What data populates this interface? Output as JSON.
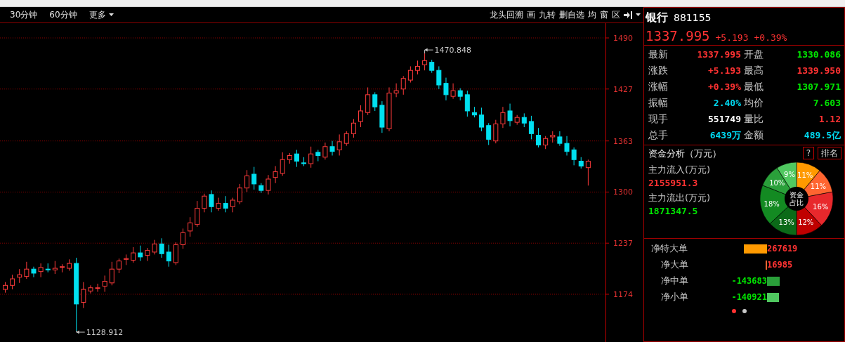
{
  "toolbar": {
    "left": [
      {
        "label": "30分钟",
        "dropdown": false
      },
      {
        "label": "60分钟",
        "dropdown": false
      },
      {
        "label": "更多",
        "dropdown": true
      }
    ],
    "right": [
      "龙头回溯",
      "画",
      "九转",
      "删自选",
      "均",
      "窗",
      "区"
    ]
  },
  "chart": {
    "chart_data": {
      "type": "candlestick",
      "grid": true,
      "ohlc": [
        [
          1180,
          1189,
          1176,
          1185
        ],
        [
          1185,
          1198,
          1180,
          1193
        ],
        [
          1195,
          1205,
          1188,
          1198
        ],
        [
          1196,
          1214,
          1193,
          1205
        ],
        [
          1205,
          1208,
          1195,
          1200
        ],
        [
          1202,
          1212,
          1195,
          1207
        ],
        [
          1205,
          1212,
          1201,
          1204
        ],
        [
          1204,
          1215,
          1199,
          1206
        ],
        [
          1208,
          1211,
          1201,
          1208
        ],
        [
          1206,
          1217,
          1203,
          1212
        ],
        [
          1212,
          1219,
          1128.912,
          1162
        ],
        [
          1164,
          1189,
          1157,
          1180
        ],
        [
          1178,
          1185,
          1175,
          1182
        ],
        [
          1182,
          1187,
          1177,
          1182
        ],
        [
          1184,
          1197,
          1177,
          1190
        ],
        [
          1188,
          1214,
          1185,
          1205
        ],
        [
          1205,
          1218,
          1200,
          1215
        ],
        [
          1217,
          1223,
          1210,
          1218
        ],
        [
          1216,
          1232,
          1213,
          1225
        ],
        [
          1225,
          1234,
          1215,
          1220
        ],
        [
          1222,
          1231,
          1215,
          1228
        ],
        [
          1226,
          1241,
          1223,
          1236
        ],
        [
          1236,
          1243,
          1219,
          1224
        ],
        [
          1226,
          1235,
          1208,
          1215
        ],
        [
          1213,
          1238,
          1210,
          1235
        ],
        [
          1235,
          1255,
          1230,
          1250
        ],
        [
          1252,
          1269,
          1245,
          1262
        ],
        [
          1260,
          1289,
          1257,
          1280
        ],
        [
          1280,
          1298,
          1275,
          1295
        ],
        [
          1297,
          1302,
          1275,
          1282
        ],
        [
          1280,
          1293,
          1277,
          1286
        ],
        [
          1286,
          1295,
          1275,
          1280
        ],
        [
          1282,
          1293,
          1275,
          1290
        ],
        [
          1288,
          1310,
          1285,
          1305
        ],
        [
          1305,
          1327,
          1300,
          1320
        ],
        [
          1322,
          1331,
          1303,
          1310
        ],
        [
          1308,
          1311,
          1299,
          1302
        ],
        [
          1302,
          1321,
          1297,
          1316
        ],
        [
          1318,
          1332,
          1311,
          1325
        ],
        [
          1323,
          1349,
          1320,
          1340
        ],
        [
          1340,
          1348,
          1335,
          1345
        ],
        [
          1347,
          1352,
          1331,
          1338
        ],
        [
          1336,
          1343,
          1332,
          1335
        ],
        [
          1335,
          1356,
          1330,
          1347
        ],
        [
          1349,
          1352,
          1338,
          1345
        ],
        [
          1343,
          1361,
          1340,
          1356
        ],
        [
          1356,
          1363,
          1345,
          1350
        ],
        [
          1352,
          1371,
          1345,
          1362
        ],
        [
          1360,
          1375,
          1357,
          1372
        ],
        [
          1372,
          1390,
          1367,
          1385
        ],
        [
          1387,
          1407,
          1380,
          1400
        ],
        [
          1398,
          1429,
          1395,
          1420
        ],
        [
          1420,
          1423,
          1400,
          1405
        ],
        [
          1407,
          1412,
          1373,
          1380
        ],
        [
          1378,
          1429,
          1375,
          1422
        ],
        [
          1422,
          1434,
          1417,
          1425
        ],
        [
          1427,
          1443,
          1420,
          1440
        ],
        [
          1438,
          1455,
          1435,
          1450
        ],
        [
          1450,
          1462,
          1445,
          1455
        ],
        [
          1457,
          1470.848,
          1450,
          1462
        ],
        [
          1460,
          1463,
          1447,
          1450
        ],
        [
          1450,
          1455,
          1427,
          1432
        ],
        [
          1434,
          1441,
          1413,
          1420
        ],
        [
          1418,
          1434,
          1415,
          1425
        ],
        [
          1425,
          1428,
          1413,
          1418
        ],
        [
          1420,
          1425,
          1393,
          1400
        ],
        [
          1398,
          1405,
          1392,
          1395
        ],
        [
          1395,
          1404,
          1375,
          1380
        ],
        [
          1382,
          1385,
          1358,
          1365
        ],
        [
          1363,
          1389,
          1360,
          1384
        ],
        [
          1384,
          1405,
          1379,
          1398
        ],
        [
          1400,
          1409,
          1381,
          1388
        ],
        [
          1386,
          1395,
          1383,
          1392
        ],
        [
          1392,
          1397,
          1380,
          1385
        ],
        [
          1387,
          1394,
          1365,
          1372
        ],
        [
          1370,
          1379,
          1355,
          1358
        ],
        [
          1358,
          1369,
          1353,
          1366
        ],
        [
          1368,
          1375,
          1361,
          1370
        ],
        [
          1368,
          1375,
          1357,
          1360
        ],
        [
          1360,
          1369,
          1345,
          1350
        ],
        [
          1352,
          1355,
          1333,
          1340
        ],
        [
          1338,
          1343,
          1329,
          1332
        ],
        [
          1330.086,
          1339.95,
          1307.971,
          1337.995
        ]
      ],
      "ylim": [
        1115,
        1490
      ],
      "yticks": [
        1490,
        1427,
        1363,
        1300,
        1237,
        1174
      ],
      "annotations": [
        "1470.848",
        "1128.912"
      ]
    }
  },
  "quote": {
    "name": "银行",
    "code": "881155",
    "price": "1337.995",
    "change": "+5.193",
    "change_pct": "+0.39%",
    "stats": [
      {
        "label": "最新",
        "value": "1337.995",
        "color": "#ff3232"
      },
      {
        "label": "开盘",
        "value": "1330.086",
        "color": "#00e600"
      },
      {
        "label": "涨跌",
        "value": "+5.193",
        "color": "#ff3232"
      },
      {
        "label": "最高",
        "value": "1339.950",
        "color": "#ff3232"
      },
      {
        "label": "涨幅",
        "value": "+0.39%",
        "color": "#ff3232"
      },
      {
        "label": "最低",
        "value": "1307.971",
        "color": "#00e600"
      },
      {
        "label": "振幅",
        "value": "2.40%",
        "color": "#00d8f0"
      },
      {
        "label": "均价",
        "value": "7.603",
        "color": "#00e600"
      },
      {
        "label": "现手",
        "value": "551749",
        "color": "#ffffff"
      },
      {
        "label": "量比",
        "value": "1.12",
        "color": "#ff3232"
      },
      {
        "label": "总手",
        "value": "6439万",
        "color": "#00d8f0"
      },
      {
        "label": "金额",
        "value": "489.5亿",
        "color": "#00d8f0"
      }
    ]
  },
  "fund_analysis": {
    "title": "资金分析（万元）",
    "help_button": "?",
    "rank_button": "排名",
    "inflow_label": "主力流入(万元)",
    "inflow_value": "2155951.3",
    "outflow_label": "主力流出(万元)",
    "outflow_value": "1871347.5",
    "center_label": "资金占比",
    "chart_data": {
      "type": "donut",
      "values": [
        11,
        11,
        16,
        12,
        13,
        18,
        10,
        9
      ],
      "value_labels": [
        "11%",
        "11%",
        "16%",
        "12%",
        "13%",
        "18%",
        "10%",
        "9%"
      ],
      "colors": [
        "#ff9a00",
        "#ff6530",
        "#e8282c",
        "#c00000",
        "#0b6a18",
        "#138a22",
        "#2aa03a",
        "#50c860"
      ]
    }
  },
  "net_flows": [
    {
      "label": "净特大单",
      "value": "267619",
      "kind": "inflow",
      "color": "#ff9a00"
    },
    {
      "label": "净大单",
      "value": "16985",
      "kind": "inflow",
      "color": "#ff6530"
    },
    {
      "label": "净中单",
      "value": "-143683",
      "kind": "outflow",
      "color": "#2aa03a"
    },
    {
      "label": "净小单",
      "value": "-140921",
      "kind": "outflow",
      "color": "#50c860"
    }
  ],
  "pages": [
    {
      "selected": true
    },
    {
      "selected": false
    }
  ]
}
